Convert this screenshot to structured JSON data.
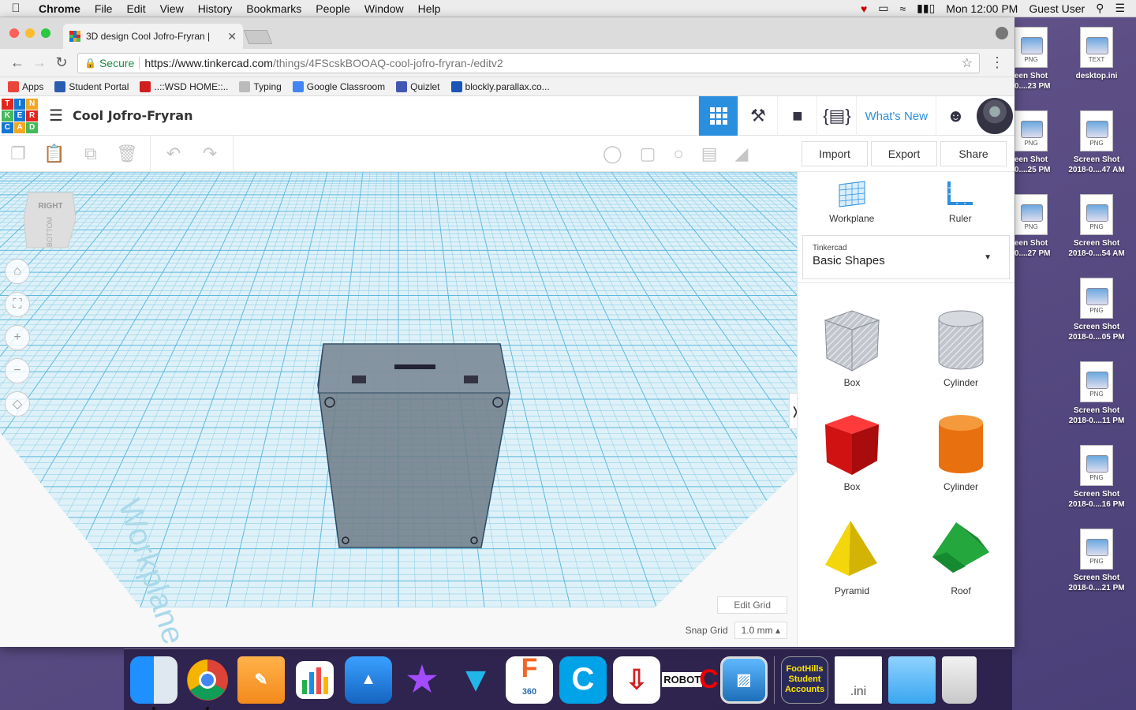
{
  "menubar": {
    "app": "Chrome",
    "items": [
      "File",
      "Edit",
      "View",
      "History",
      "Bookmarks",
      "People",
      "Window",
      "Help"
    ],
    "clock": "Mon 12:00 PM",
    "user": "Guest User"
  },
  "browser": {
    "tab_title": "3D design Cool Jofro-Fryran |",
    "secure_label": "Secure",
    "url_host": "https://www.tinkercad.com",
    "url_path": "/things/4FScskBOOAQ-cool-jofro-fryran-/editv2",
    "bookmarks": [
      {
        "label": "Apps",
        "color": "#e8453c"
      },
      {
        "label": "Student Portal",
        "color": "#2a5db0"
      },
      {
        "label": "..::WSD HOME::..",
        "color": "#d01f1f"
      },
      {
        "label": "Typing",
        "color": "#bbbbbb"
      },
      {
        "label": "Google Classroom",
        "color": "#4285f4"
      },
      {
        "label": "Quizlet",
        "color": "#4257b2"
      },
      {
        "label": "blockly.parallax.co...",
        "color": "#1a56b8"
      }
    ]
  },
  "tinkercad": {
    "logo_letters": [
      "T",
      "I",
      "N",
      "K",
      "E",
      "R",
      "C",
      "A",
      "D"
    ],
    "design_title": "Cool Jofro-Fryran",
    "whats_new": "What's New",
    "import_label": "Import",
    "export_label": "Export",
    "share_label": "Share",
    "viewcube_top": "RIGHT",
    "viewcube_front": "BOTTOM",
    "workplane_watermark": "Workplane",
    "edit_grid": "Edit Grid",
    "snap_grid_label": "Snap Grid",
    "snap_grid_value": "1.0 mm",
    "panel": {
      "workplane_label": "Workplane",
      "ruler_label": "Ruler",
      "library_small": "Tinkercad",
      "library_big": "Basic Shapes",
      "shapes": [
        {
          "label": "Box",
          "color": "#b9bdc6"
        },
        {
          "label": "Cylinder",
          "color": "#c7cad1"
        },
        {
          "label": "Box",
          "color": "#e0191b"
        },
        {
          "label": "Cylinder",
          "color": "#f07b12"
        },
        {
          "label": "Pyramid",
          "color": "#f2d20a"
        },
        {
          "label": "Roof",
          "color": "#20a03a"
        }
      ]
    }
  },
  "desktop": {
    "icons": [
      {
        "label1": "een Shot",
        "label2": "-0....23 PM",
        "type": "PNG"
      },
      {
        "label1": "desktop.ini",
        "label2": "",
        "type": "TEXT"
      },
      {
        "label1": "een Shot",
        "label2": "-0....25 PM",
        "type": "PNG"
      },
      {
        "label1": "Screen Shot",
        "label2": "2018-0....47 AM",
        "type": "PNG"
      },
      {
        "label1": "een Shot",
        "label2": "-0....27 PM",
        "type": "PNG"
      },
      {
        "label1": "Screen Shot",
        "label2": "2018-0....54 AM",
        "type": "PNG"
      },
      {
        "label1": "Screen Shot",
        "label2": "2018-0....05 PM",
        "type": "PNG"
      },
      {
        "label1": "Screen Shot",
        "label2": "2018-0....11 PM",
        "type": "PNG"
      },
      {
        "label1": "Screen Shot",
        "label2": "2018-0....16 PM",
        "type": "PNG"
      },
      {
        "label1": "Screen Shot",
        "label2": "2018-0....21 PM",
        "type": "PNG"
      }
    ]
  },
  "dock": {
    "fusion_label": "360",
    "foothills_label": "FootHills Student Accounts",
    "ini_label": ".ini",
    "robot_label": "ROBOT"
  }
}
